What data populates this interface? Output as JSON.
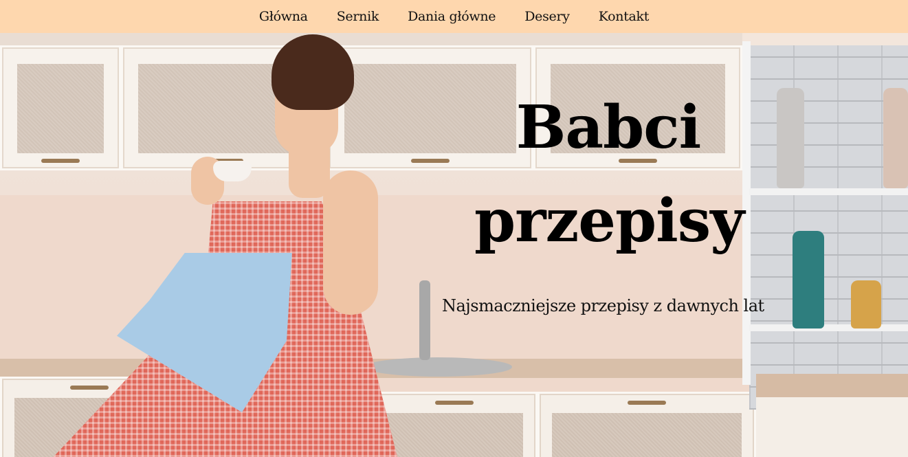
{
  "nav": {
    "items": [
      {
        "label": "Główna"
      },
      {
        "label": "Sernik"
      },
      {
        "label": "Dania główne"
      },
      {
        "label": "Desery"
      },
      {
        "label": "Kontakt"
      }
    ],
    "background": "#fed7ae"
  },
  "hero": {
    "title": "Babci przepisy",
    "subtitle": "Najsmaczniejsze przepisy z dawnych lat"
  }
}
